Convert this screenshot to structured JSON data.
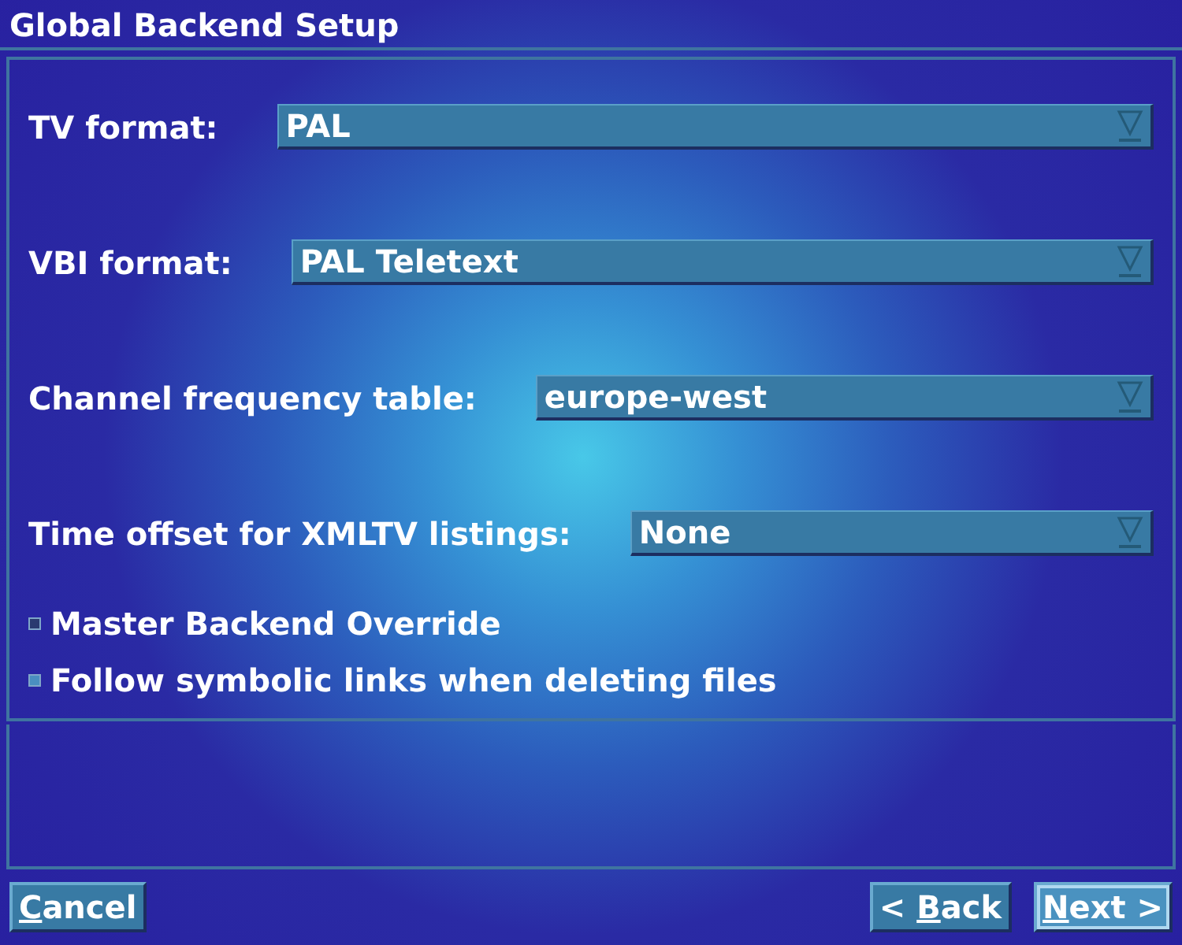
{
  "window": {
    "title": "Global Backend Setup"
  },
  "settings": [
    {
      "label": "TV format:",
      "value": "PAL"
    },
    {
      "label": "VBI format:",
      "value": "PAL Teletext"
    },
    {
      "label": "Channel frequency table:",
      "value": "europe-west"
    },
    {
      "label": "Time offset for XMLTV listings:",
      "value": "None"
    }
  ],
  "checkboxes": [
    {
      "label": "Master Backend Override",
      "checked": false,
      "focused": false
    },
    {
      "label": "Follow symbolic links when deleting files",
      "checked": false,
      "focused": true
    }
  ],
  "buttons": [
    {
      "mnemonic": "C",
      "label_after": "ancel",
      "focused": false
    },
    {
      "label_before": "< ",
      "mnemonic": "B",
      "label_after": "ack",
      "focused": false
    },
    {
      "mnemonic": "N",
      "label_after": "ext >",
      "focused": true
    }
  ]
}
